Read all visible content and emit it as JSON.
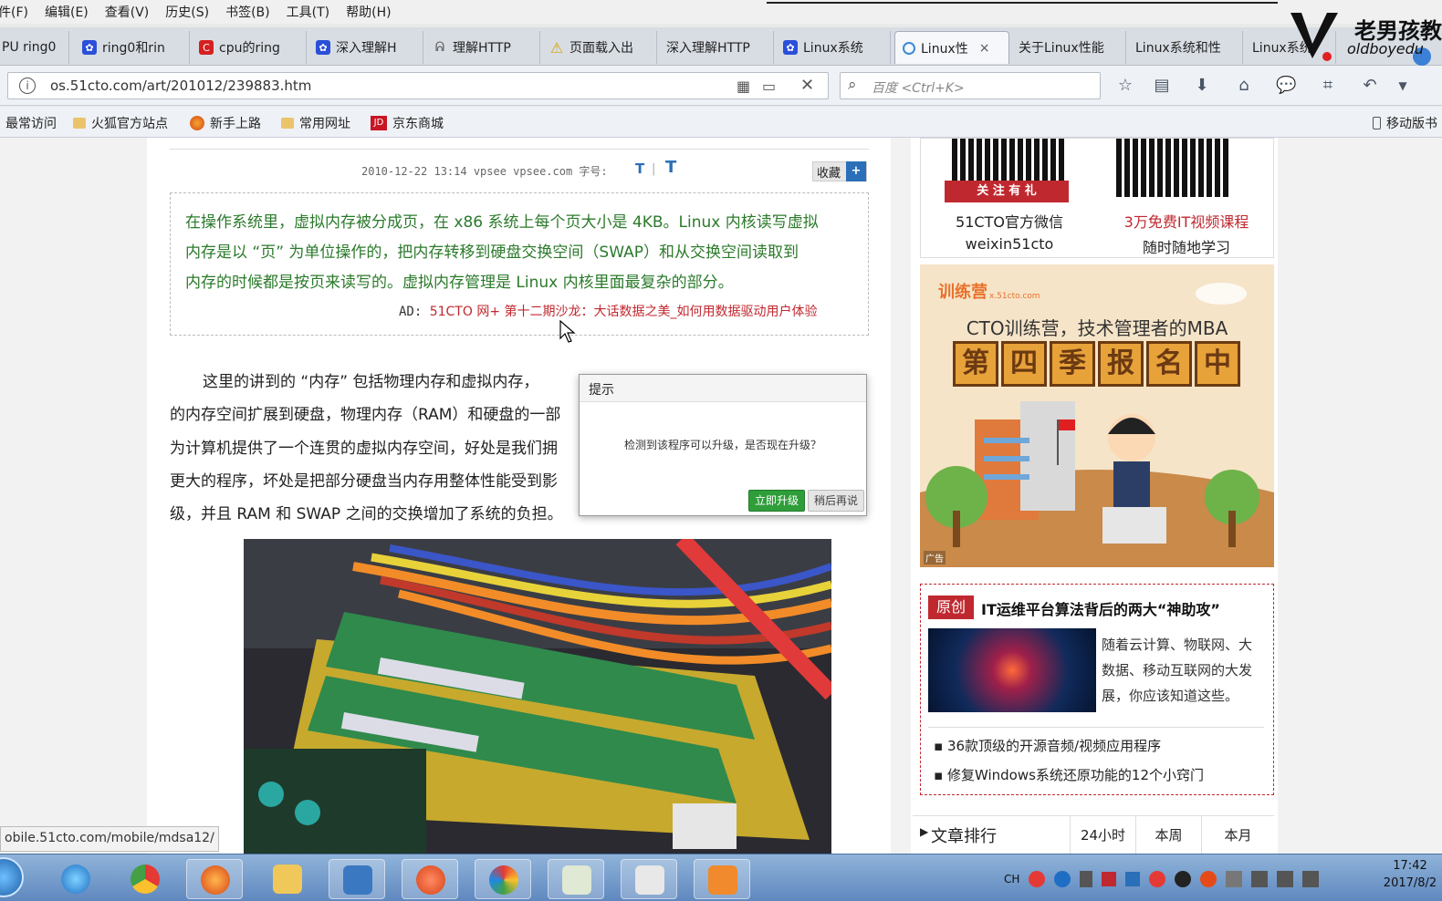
{
  "menu": [
    "件(F)",
    "编辑(E)",
    "查看(V)",
    "历史(S)",
    "书签(B)",
    "工具(T)",
    "帮助(H)"
  ],
  "tabs": [
    {
      "label": "PU ring0",
      "icon": "doc-icon"
    },
    {
      "label": "ring0和rin",
      "icon": "baidu-icon"
    },
    {
      "label": "cpu的ring",
      "icon": "c-icon"
    },
    {
      "label": "深入理解H",
      "icon": "baidu-icon"
    },
    {
      "label": "理解HTTP",
      "icon": "spider-icon"
    },
    {
      "label": "页面载入出",
      "icon": "warning-icon"
    },
    {
      "label": "深入理解HTTP",
      "icon": "doc-icon"
    },
    {
      "label": "Linux系统",
      "icon": "baidu-icon"
    },
    {
      "label": "Linux性",
      "icon": "loading-icon",
      "close": "×"
    },
    {
      "label": "关于Linux性能",
      "icon": "doc-icon"
    },
    {
      "label": "Linux系统和性",
      "icon": "doc-icon"
    },
    {
      "label": "Linux系统",
      "icon": "doc-icon"
    }
  ],
  "watermark": {
    "title": "老男孩教",
    "sub": "oldboyedu"
  },
  "address": {
    "url": "os.51cto.com/art/201012/239883.htm",
    "search_placeholder": "百度 <Ctrl+K>"
  },
  "bookmarks": [
    {
      "label": "最常访问",
      "icon": "gear-icon"
    },
    {
      "label": "火狐官方站点",
      "icon": "folder-icon"
    },
    {
      "label": "新手上路",
      "icon": "firefox-icon"
    },
    {
      "label": "常用网址",
      "icon": "folder-icon"
    },
    {
      "label": "京东商城",
      "icon": "jd-icon"
    }
  ],
  "mobile_bookmarks": "移动版书",
  "article": {
    "meta": "2010-12-22 13:14 vpsee vpsee.com 字号:",
    "font_t1": "T",
    "font_sep": "|",
    "font_t2": "T",
    "collect": "收藏",
    "collect_plus": "+",
    "summary": [
      "在操作系统里，虚拟内存被分成页，在 x86 系统上每个页大小是 4KB。Linux 内核读写虚拟",
      "内存是以 “页” 为单位操作的，把内存转移到硬盘交换空间（SWAP）和从交换空间读取到",
      "内存的时候都是按页来读写的。虚拟内存管理是 Linux 内核里面最复杂的部分。"
    ],
    "ad_prefix": "AD: ",
    "ad_text": "51CTO 网+ 第十二期沙龙：大话数据之美_如何用数据驱动用户体验",
    "body": [
      "这里的讲到的 “内存” 包括物理内存和虚拟内存，",
      "的内存空间扩展到硬盘，物理内存（RAM）和硬盘的一部",
      "为计算机提供了一个连贯的虚拟内存空间，好处是我们拥",
      "更大的程序，坏处是把部分硬盘当内存用整体性能受到影",
      "级，并且 RAM 和 SWAP 之间的交换增加了系统的负担。"
    ]
  },
  "dialog": {
    "title": "提示",
    "message": "检测到该程序可以升级，是否现在升级？",
    "ok": "立即升级",
    "later": "稍后再说"
  },
  "sidebar": {
    "qr1_badge": "关 注 有 礼",
    "qr1_title": "51CTO官方微信",
    "qr1_sub": "weixin51cto",
    "qr2_title_a": "3万免费IT视频",
    "qr2_title_b": "课程",
    "qr2_sub": "随时随地学习",
    "banner_logo": "训练营",
    "banner_logo_sub": "x.51cto.com",
    "banner_slogan": "CTO训练营，技术管理者的MBA",
    "banner_chars": [
      "第",
      "四",
      "季",
      "报",
      "名",
      "中"
    ],
    "banner_ad": "广告",
    "orig_tag": "原创",
    "orig_title": "IT运维平台算法背后的两大“神助攻”",
    "orig_desc": [
      "随着云计算、物联网、大",
      "数据、移动互联网的大发",
      "展，你应该知道这些。"
    ],
    "orig_links": [
      "36款顶级的开源音频/视频应用程序",
      "修复Windows系统还原功能的12个小窍门"
    ],
    "rank_title": "文章排行",
    "rank_tabs": [
      "24小时",
      "本周",
      "本月"
    ]
  },
  "status_url": "obile.51cto.com/mobile/mdsa12/",
  "tray": {
    "lang": "CH",
    "time": "17:42",
    "date": "2017/8/2"
  },
  "colors": {
    "green": "#2b7a2b",
    "red": "#c0282f",
    "blue": "#2a6fb8"
  }
}
